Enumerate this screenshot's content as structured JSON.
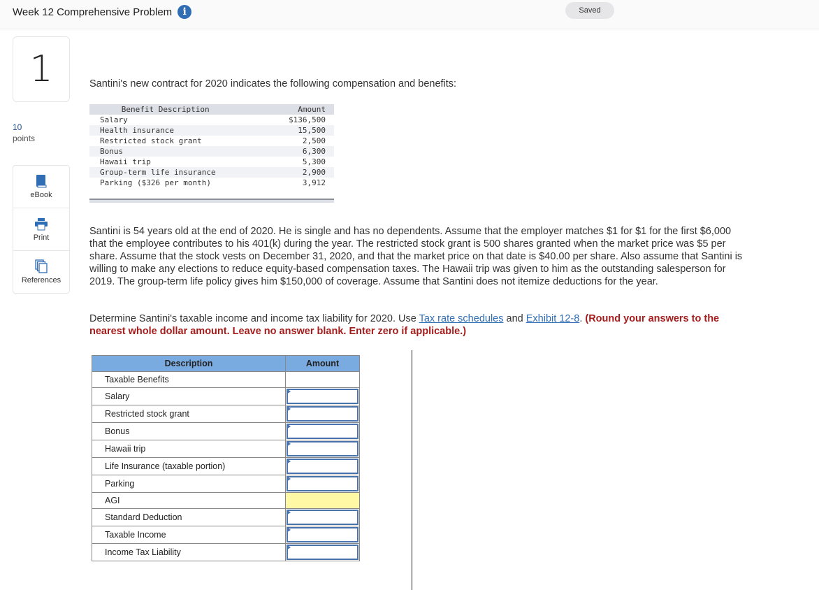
{
  "header": {
    "title": "Week 12 Comprehensive Problem",
    "info_icon": "info-circle-icon",
    "saved_label": "Saved"
  },
  "question": {
    "number": "1",
    "points_value": "10",
    "points_label": "points"
  },
  "tools": [
    {
      "label": "eBook",
      "icon": "book-icon"
    },
    {
      "label": "Print",
      "icon": "printer-icon"
    },
    {
      "label": "References",
      "icon": "documents-icon"
    }
  ],
  "intro": "Santini's new contract for 2020 indicates the following compensation and benefits:",
  "benefits_table": {
    "headers": {
      "description": "Benefit Description",
      "amount": "Amount"
    },
    "rows": [
      {
        "description": "Salary",
        "amount": "$136,500"
      },
      {
        "description": "Health insurance",
        "amount": "15,500"
      },
      {
        "description": "Restricted stock grant",
        "amount": "2,500"
      },
      {
        "description": "Bonus",
        "amount": "6,300"
      },
      {
        "description": "Hawaii trip",
        "amount": "5,300"
      },
      {
        "description": "Group-term life insurance",
        "amount": "2,900"
      },
      {
        "description": "Parking ($326 per month)",
        "amount": "3,912"
      }
    ]
  },
  "paragraph": "Santini is 54 years old at the end of 2020. He is single and has no dependents. Assume that the employer matches $1 for $1 for the first $6,000 that the employee contributes to his 401(k) during the year. The restricted stock grant is 500 shares granted when the market price was $5 per share. Assume that the stock vests on December 31, 2020, and that the market price on that date is $40.00 per share. Also assume that Santini is willing to make any elections to reduce equity-based compensation taxes. The Hawaii trip was given to him as the outstanding salesperson for 2019. The group-term life policy gives him $150,000 of coverage. Assume that Santini does not itemize deductions for the year.",
  "instructions": {
    "text_before": "Determine Santini's taxable income and income tax liability for 2020. Use ",
    "link1": "Tax rate schedules",
    "text_between": " and ",
    "link2": "Exhibit 12-8",
    "text_after": ". ",
    "emphasis": "(Round your answers to the nearest whole dollar amount. Leave no answer blank. Enter zero if applicable.)"
  },
  "answer_table": {
    "headers": {
      "description": "Description",
      "amount": "Amount"
    },
    "rows": [
      {
        "description": "Taxable Benefits",
        "type": "none",
        "value": ""
      },
      {
        "description": "Salary",
        "type": "input",
        "value": ""
      },
      {
        "description": "Restricted stock grant",
        "type": "input",
        "value": ""
      },
      {
        "description": "Bonus",
        "type": "input",
        "value": ""
      },
      {
        "description": "Hawaii trip",
        "type": "input",
        "value": ""
      },
      {
        "description": "Life Insurance (taxable portion)",
        "type": "input",
        "value": ""
      },
      {
        "description": "Parking",
        "type": "input",
        "value": ""
      },
      {
        "description": "AGI",
        "type": "calculated",
        "value": ""
      },
      {
        "description": "Standard Deduction",
        "type": "input",
        "value": ""
      },
      {
        "description": "Taxable Income",
        "type": "input",
        "value": ""
      },
      {
        "description": "Income Tax Liability",
        "type": "input",
        "value": ""
      }
    ]
  },
  "colors": {
    "header_bg": "#7aabe0",
    "input_border": "#4a72ad",
    "calculated_bg": "#fff9a6",
    "emphasis_red": "#a51c1c",
    "link_blue": "#2f6db5"
  }
}
